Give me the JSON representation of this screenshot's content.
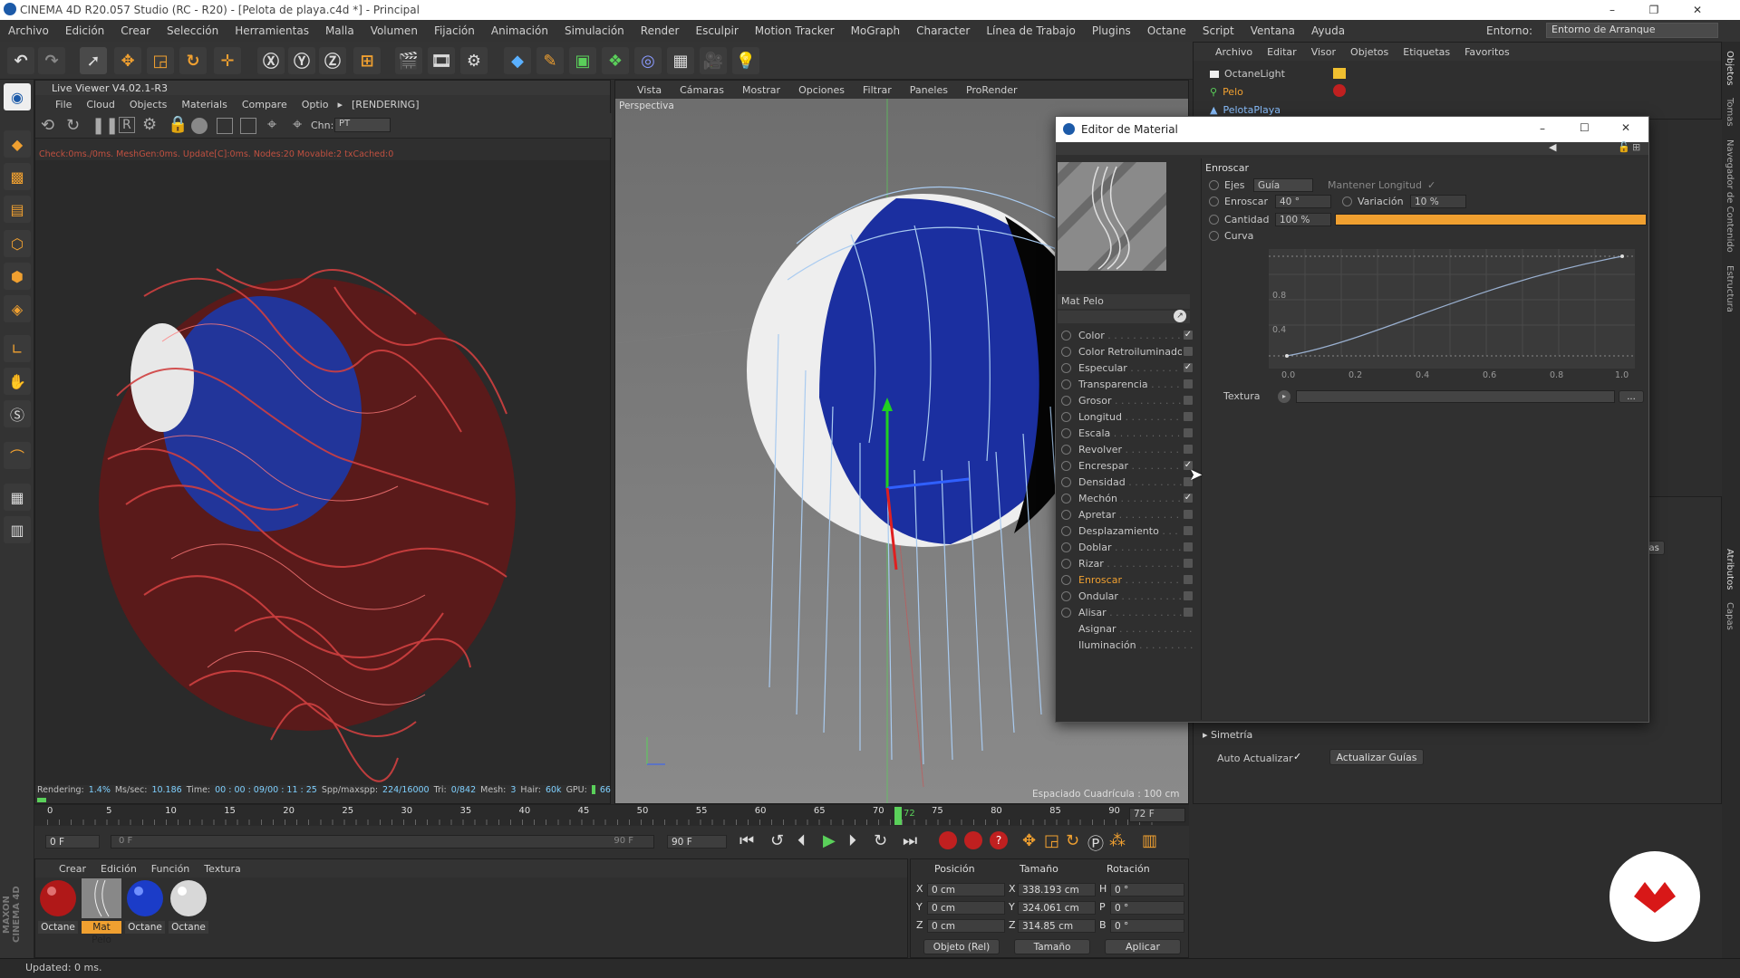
{
  "window": {
    "title": "CINEMA 4D R20.057 Studio (RC - R20) - [Pelota de playa.c4d *] - Principal",
    "minimize": "–",
    "restore": "❐",
    "close": "✕"
  },
  "menu": [
    "Archivo",
    "Edición",
    "Crear",
    "Selección",
    "Herramientas",
    "Malla",
    "Volumen",
    "Fijación",
    "Animación",
    "Simulación",
    "Render",
    "Esculpir",
    "Motion Tracker",
    "MoGraph",
    "Character",
    "Línea de Trabajo",
    "Plugins",
    "Octane",
    "Script",
    "Ventana",
    "Ayuda"
  ],
  "environment": {
    "label": "Entorno:",
    "value": "Entorno de Arranque"
  },
  "live_viewer": {
    "title": "Live Viewer V4.02.1-R3",
    "menu": [
      "File",
      "Cloud",
      "Objects",
      "Materials",
      "Compare",
      "Optio"
    ],
    "state": "[RENDERING]",
    "chn_label": "Chn:",
    "chn_value": "PT",
    "check_line": "Check:0ms./0ms. MeshGen:0ms. Update[C]:0ms. Nodes:20 Movable:2 txCached:0",
    "status": {
      "rendering_label": "Rendering:",
      "rendering_val": "1.4%",
      "mssec_label": "Ms/sec:",
      "mssec_val": "10.186",
      "time_label": "Time:",
      "time_val": "00 : 00 : 09/00 : 11 : 25",
      "spp_label": "Spp/maxspp:",
      "spp_val": "224/16000",
      "tri_label": "Tri:",
      "tri_val": "0/842",
      "mesh_label": "Mesh:",
      "mesh_val": "3",
      "hair_label": "Hair:",
      "hair_val": "60k",
      "gpu_label": "GPU:",
      "gpu_val": "66"
    }
  },
  "viewport": {
    "menu": [
      "Vista",
      "Cámaras",
      "Mostrar",
      "Opciones",
      "Filtrar",
      "Paneles",
      "ProRender"
    ],
    "label": "Perspectiva",
    "grid": "Espaciado Cuadrícula : 100 cm"
  },
  "object_manager": {
    "menu": [
      "Archivo",
      "Editar",
      "Visor",
      "Objetos",
      "Etiquetas",
      "Favoritos"
    ],
    "items": [
      "OctaneLight",
      "Pelo",
      "PelotaPlaya"
    ]
  },
  "side_tabs": [
    "Objetos",
    "Tomas",
    "Navegador de Contenido",
    "Estructura"
  ],
  "side_tabs2": [
    "Atributos",
    "Capas"
  ],
  "material_editor": {
    "title": "Editor de Material",
    "material_name": "Mat Pelo",
    "channels": [
      {
        "label": "Color",
        "checked": "✓"
      },
      {
        "label": "Color Retroiluminado",
        "checked": ""
      },
      {
        "label": "Especular",
        "checked": "✓"
      },
      {
        "label": "Transparencia",
        "checked": ""
      },
      {
        "label": "Grosor",
        "checked": ""
      },
      {
        "label": "Longitud",
        "checked": ""
      },
      {
        "label": "Escala",
        "checked": ""
      },
      {
        "label": "Revolver",
        "checked": ""
      },
      {
        "label": "Encrespar",
        "checked": "✓"
      },
      {
        "label": "Densidad",
        "checked": ""
      },
      {
        "label": "Mechón",
        "checked": "✓"
      },
      {
        "label": "Apretar",
        "checked": ""
      },
      {
        "label": "Desplazamiento",
        "checked": ""
      },
      {
        "label": "Doblar",
        "checked": ""
      },
      {
        "label": "Rizar",
        "checked": ""
      },
      {
        "label": "Enroscar",
        "checked": ""
      },
      {
        "label": "Ondular",
        "checked": ""
      },
      {
        "label": "Alisar",
        "checked": ""
      },
      {
        "label": "Asignar",
        "checked": ""
      },
      {
        "label": "Iluminación",
        "checked": ""
      }
    ],
    "section": "Enroscar",
    "ejes_label": "Ejes",
    "ejes_value": "Guía",
    "mantener": "Mantener Longitud",
    "mantener_check": "✓",
    "enroscar_label": "Enroscar",
    "enroscar_value": "40 °",
    "variacion_label": "Variación",
    "variacion_value": "10 %",
    "cantidad_label": "Cantidad",
    "cantidad_value": "100 %",
    "cantidad_fraction": 1.0,
    "curva_label": "Curva",
    "textura_label": "Textura",
    "textura_btn": "...",
    "curve": {
      "y_ticks": [
        "0.8",
        "0.4"
      ],
      "x_ticks": [
        "0.0",
        "0.2",
        "0.4",
        "0.6",
        "0.8",
        "1.0"
      ]
    }
  },
  "attributes": {
    "simetria": "Simetría",
    "auto_actualizar": "Auto Actualizar",
    "auto_check": "✓",
    "update_btn": "Actualizar Guías",
    "partial_tab": "icas"
  },
  "timeline": {
    "ticks": [
      "0",
      "5",
      "10",
      "15",
      "20",
      "25",
      "30",
      "35",
      "40",
      "45",
      "50",
      "55",
      "60",
      "65",
      "70",
      "75",
      "80",
      "85",
      "90"
    ],
    "current_frame": "72",
    "frame_field": "72 F",
    "start": "0 F",
    "range_start": "0 F",
    "range_end": "90 F",
    "end": "90 F"
  },
  "materials_panel": {
    "menu": [
      "Crear",
      "Edición",
      "Función",
      "Textura"
    ],
    "materials": [
      "Octane",
      "Mat Pelo",
      "Octane",
      "Octane"
    ]
  },
  "coords": {
    "headers": [
      "Posición",
      "Tamaño",
      "Rotación"
    ],
    "rows": [
      {
        "axis": "X",
        "pos": "0 cm",
        "size": "338.193 cm",
        "rot_axis": "H",
        "rot": "0 °"
      },
      {
        "axis": "Y",
        "pos": "0 cm",
        "size": "324.061 cm",
        "rot_axis": "P",
        "rot": "0 °"
      },
      {
        "axis": "Z",
        "pos": "0 cm",
        "size": "314.85 cm",
        "rot_axis": "B",
        "rot": "0 °"
      }
    ],
    "mode": "Objeto (Rel)",
    "size_mode": "Tamaño",
    "apply": "Aplicar"
  },
  "status_bar": "Updated: 0 ms.",
  "brand": "MAXON CINEMA 4D"
}
